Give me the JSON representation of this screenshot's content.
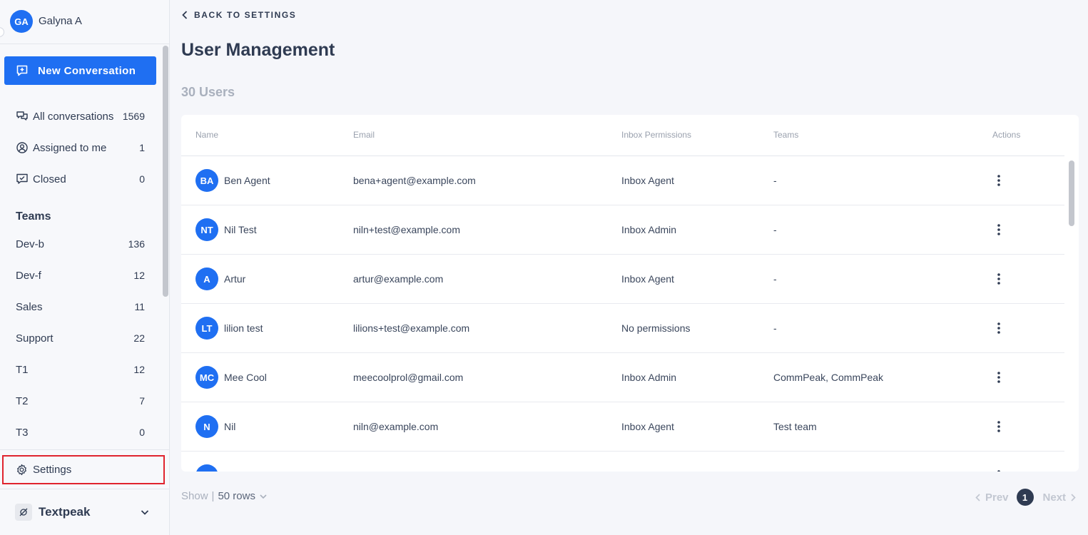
{
  "profile": {
    "initials": "GA",
    "name": "Galyna A"
  },
  "sidebar": {
    "new_conversation": "New Conversation",
    "nav": [
      {
        "label": "All conversations",
        "count": "1569",
        "icon": "chat-bubbles-icon"
      },
      {
        "label": "Assigned to me",
        "count": "1",
        "icon": "user-circle-icon"
      },
      {
        "label": "Closed",
        "count": "0",
        "icon": "checkbox-chat-icon"
      }
    ],
    "teams_heading": "Teams",
    "teams": [
      {
        "label": "Dev-b",
        "count": "136"
      },
      {
        "label": "Dev-f",
        "count": "12"
      },
      {
        "label": "Sales",
        "count": "11"
      },
      {
        "label": "Support",
        "count": "22"
      },
      {
        "label": "T1",
        "count": "12"
      },
      {
        "label": "T2",
        "count": "7"
      },
      {
        "label": "T3",
        "count": "0"
      }
    ],
    "settings": "Settings",
    "workspace": "Textpeak"
  },
  "main": {
    "back": "BACK TO SETTINGS",
    "title": "User Management",
    "users_count": "30 Users",
    "columns": {
      "name": "Name",
      "email": "Email",
      "permissions": "Inbox Permissions",
      "teams": "Teams",
      "actions": "Actions"
    },
    "users": [
      {
        "initials": "BA",
        "name": "Ben Agent",
        "email": "bena+agent@example.com",
        "permissions": "Inbox Agent",
        "teams": "-"
      },
      {
        "initials": "NT",
        "name": "Nil Test",
        "email": "niln+test@example.com",
        "permissions": "Inbox Admin",
        "teams": "-"
      },
      {
        "initials": "A",
        "name": "Artur",
        "email": "artur@example.com",
        "permissions": "Inbox Agent",
        "teams": "-"
      },
      {
        "initials": "LT",
        "name": "lilion test",
        "email": "lilions+test@example.com",
        "permissions": "No permissions",
        "teams": "-"
      },
      {
        "initials": "MC",
        "name": "Mee Cool",
        "email": "meecoolprol@gmail.com",
        "permissions": "Inbox Admin",
        "teams": "CommPeak, CommPeak"
      },
      {
        "initials": "N",
        "name": "Nil",
        "email": "niln@example.com",
        "permissions": "Inbox Agent",
        "teams": "Test team"
      }
    ],
    "footer": {
      "show": "Show",
      "rows": "50 rows",
      "prev": "Prev",
      "page": "1",
      "next": "Next"
    }
  },
  "colors": {
    "accent": "#1f6ff2",
    "text": "#2f3b52",
    "muted": "#a9b0bd",
    "highlight_border": "#e0242e"
  }
}
